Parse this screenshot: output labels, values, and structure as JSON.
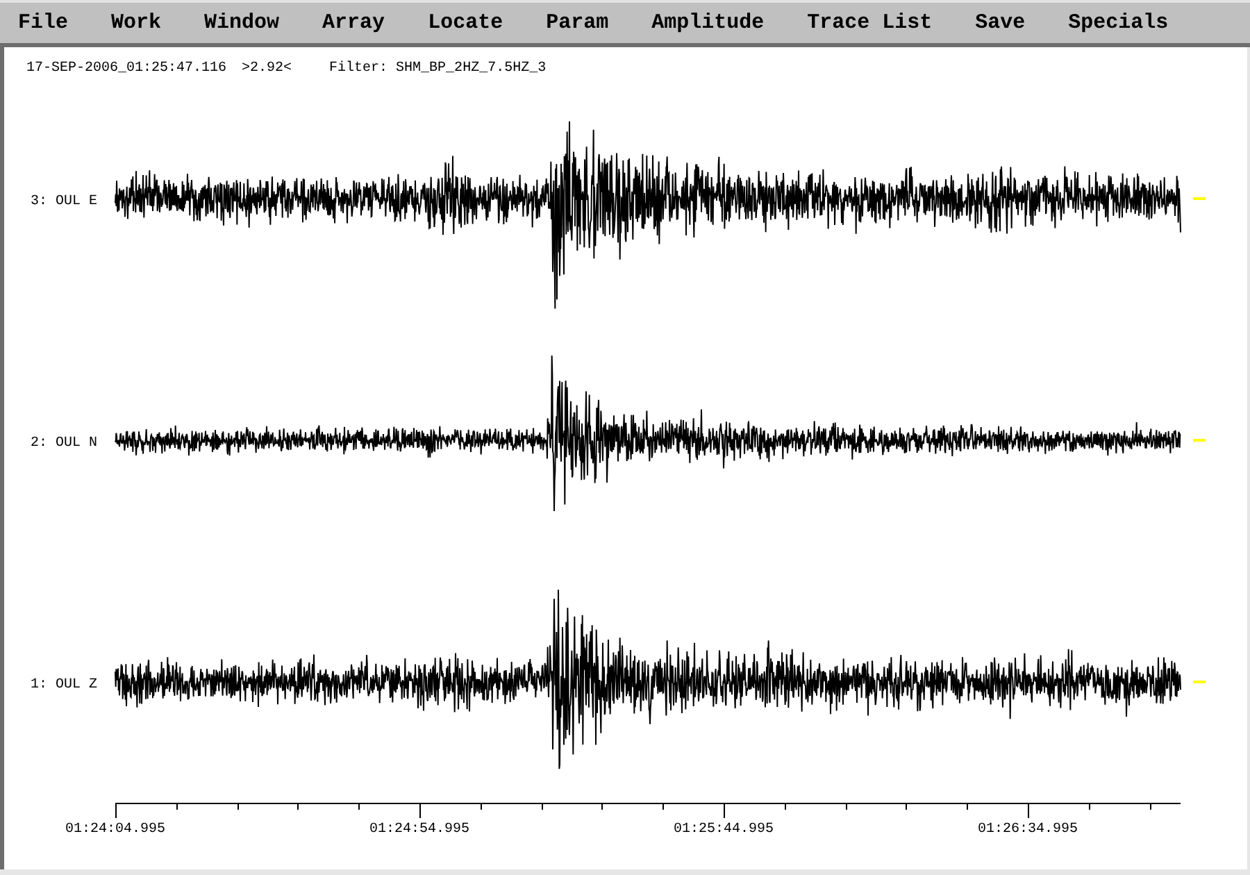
{
  "menu_bar": {
    "items": [
      "File",
      "Work",
      "Window",
      "Array",
      "Locate",
      "Param",
      "Amplitude",
      "Trace List",
      "Save",
      "Specials"
    ]
  },
  "header": {
    "timestamp": "17-SEP-2006_01:25:47.116",
    "ratio": ">2.92<",
    "filter": "Filter: SHM_BP_2HZ_7.5HZ_3"
  },
  "traces": [
    {
      "label": "3: OUL E"
    },
    {
      "label": "2: OUL N"
    },
    {
      "label": "1: OUL Z"
    }
  ],
  "time_axis": {
    "tick_labels": [
      "01:24:04.995",
      "01:24:54.995",
      "01:25:44.995",
      "01:26:34.995"
    ]
  }
}
